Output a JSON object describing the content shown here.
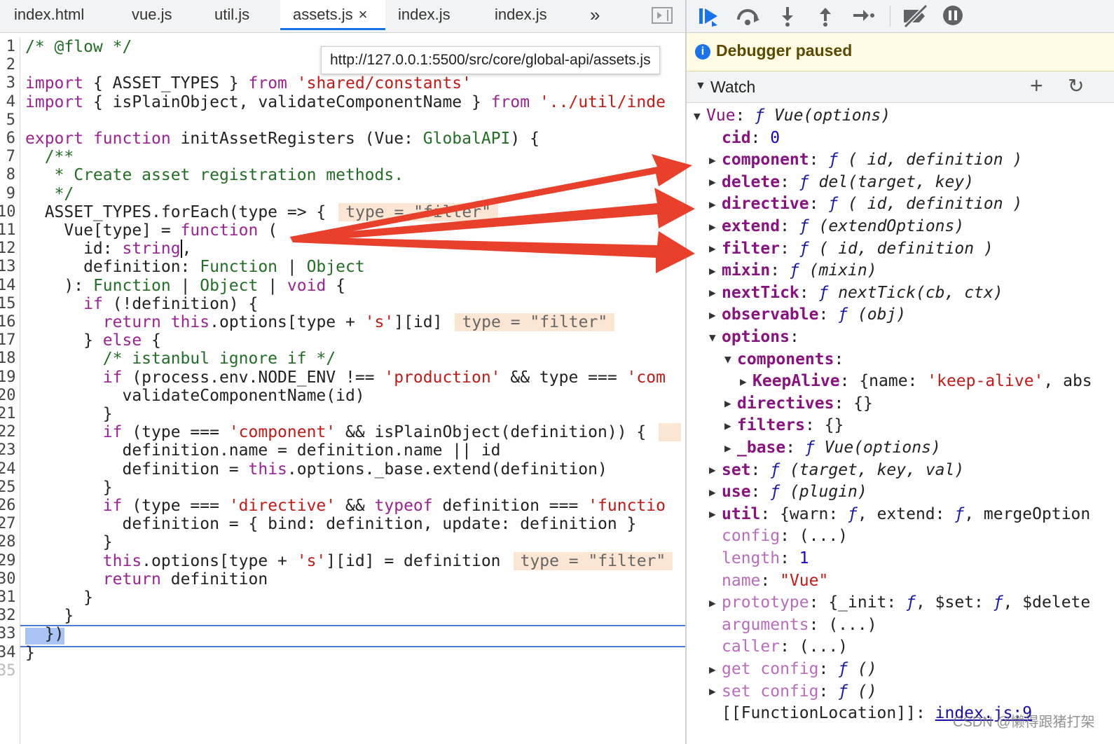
{
  "tabs": [
    {
      "label": "index.html",
      "active": false
    },
    {
      "label": "vue.js",
      "active": false
    },
    {
      "label": "util.js",
      "active": false
    },
    {
      "label": "assets.js",
      "active": true
    },
    {
      "label": "index.js",
      "active": false
    },
    {
      "label": "index.js",
      "active": false
    }
  ],
  "tab_close": "×",
  "tab_overflow": "»",
  "tooltip": "http://127.0.0.1:5500/src/core/global-api/assets.js",
  "line_numbers": [
    "1",
    "2",
    "3",
    "4",
    "5",
    "6",
    "7",
    "8",
    "9",
    "10",
    "11",
    "12",
    "13",
    "14",
    "15",
    "16",
    "17",
    "18",
    "19",
    "20",
    "21",
    "22",
    "23",
    "24",
    "25",
    "26",
    "27",
    "28",
    "29",
    "30",
    "31",
    "32",
    "33",
    "34",
    "35"
  ],
  "code": [
    [
      {
        "c": "cm",
        "t": "/* @flow */"
      }
    ],
    [],
    [
      {
        "c": "kw",
        "t": "import"
      },
      {
        "c": "",
        "t": " { ASSET_TYPES } "
      },
      {
        "c": "kw",
        "t": "from"
      },
      {
        "c": "",
        "t": " "
      },
      {
        "c": "str",
        "t": "'shared/constants'"
      }
    ],
    [
      {
        "c": "kw",
        "t": "import"
      },
      {
        "c": "",
        "t": " { isPlainObject, validateComponentName } "
      },
      {
        "c": "kw",
        "t": "from"
      },
      {
        "c": "",
        "t": " "
      },
      {
        "c": "str",
        "t": "'../util/inde"
      }
    ],
    [],
    [
      {
        "c": "kw",
        "t": "export"
      },
      {
        "c": "",
        "t": " "
      },
      {
        "c": "kw",
        "t": "function"
      },
      {
        "c": "",
        "t": " initAssetRegisters (Vue: "
      },
      {
        "c": "ty",
        "t": "GlobalAPI"
      },
      {
        "c": "",
        "t": ") {"
      }
    ],
    [
      {
        "c": "cm",
        "t": "  /**"
      }
    ],
    [
      {
        "c": "cm",
        "t": "   * Create asset registration methods."
      }
    ],
    [
      {
        "c": "cm",
        "t": "   */"
      }
    ],
    [
      {
        "c": "",
        "t": "  ASSET_TYPES.forEach(type => {"
      },
      {
        "c": "inl",
        "t": "type = \"filter\""
      }
    ],
    [
      {
        "c": "",
        "t": "    Vue[type] = "
      },
      {
        "c": "kw",
        "t": "function"
      },
      {
        "c": "",
        "t": " ("
      }
    ],
    [
      {
        "c": "",
        "t": "      id: "
      },
      {
        "c": "kw",
        "t": "string"
      },
      {
        "c": "cur",
        "t": ","
      }
    ],
    [
      {
        "c": "",
        "t": "      definition: "
      },
      {
        "c": "ty",
        "t": "Function"
      },
      {
        "c": "",
        "t": " | "
      },
      {
        "c": "ty",
        "t": "Object"
      }
    ],
    [
      {
        "c": "",
        "t": "    ): "
      },
      {
        "c": "ty",
        "t": "Function"
      },
      {
        "c": "",
        "t": " | "
      },
      {
        "c": "ty",
        "t": "Object"
      },
      {
        "c": "",
        "t": " | "
      },
      {
        "c": "kw",
        "t": "void"
      },
      {
        "c": "",
        "t": " {"
      }
    ],
    [
      {
        "c": "",
        "t": "      "
      },
      {
        "c": "kw",
        "t": "if"
      },
      {
        "c": "",
        "t": " (!definition) {"
      }
    ],
    [
      {
        "c": "",
        "t": "        "
      },
      {
        "c": "kw",
        "t": "return"
      },
      {
        "c": "",
        "t": " "
      },
      {
        "c": "kw",
        "t": "this"
      },
      {
        "c": "",
        "t": ".options[type + "
      },
      {
        "c": "str",
        "t": "'s'"
      },
      {
        "c": "",
        "t": "][id]"
      },
      {
        "c": "inl",
        "t": "type = \"filter\""
      }
    ],
    [
      {
        "c": "",
        "t": "      } "
      },
      {
        "c": "kw",
        "t": "else"
      },
      {
        "c": "",
        "t": " {"
      }
    ],
    [
      {
        "c": "cm",
        "t": "        /* istanbul ignore if */"
      }
    ],
    [
      {
        "c": "",
        "t": "        "
      },
      {
        "c": "kw",
        "t": "if"
      },
      {
        "c": "",
        "t": " (process.env.NODE_ENV !== "
      },
      {
        "c": "str",
        "t": "'production'"
      },
      {
        "c": "",
        "t": " && type === "
      },
      {
        "c": "str",
        "t": "'com"
      }
    ],
    [
      {
        "c": "",
        "t": "          validateComponentName(id)"
      }
    ],
    [
      {
        "c": "",
        "t": "        }"
      }
    ],
    [
      {
        "c": "",
        "t": "        "
      },
      {
        "c": "kw",
        "t": "if"
      },
      {
        "c": "",
        "t": " (type === "
      },
      {
        "c": "str",
        "t": "'component'"
      },
      {
        "c": "",
        "t": " && isPlainObject(definition)) {"
      },
      {
        "c": "inl",
        "t": ""
      }
    ],
    [
      {
        "c": "",
        "t": "          definition.name = definition.name || id"
      }
    ],
    [
      {
        "c": "",
        "t": "          definition = "
      },
      {
        "c": "kw",
        "t": "this"
      },
      {
        "c": "",
        "t": ".options._base.extend(definition)"
      }
    ],
    [
      {
        "c": "",
        "t": "        }"
      }
    ],
    [
      {
        "c": "",
        "t": "        "
      },
      {
        "c": "kw",
        "t": "if"
      },
      {
        "c": "",
        "t": " (type === "
      },
      {
        "c": "str",
        "t": "'directive'"
      },
      {
        "c": "",
        "t": " && "
      },
      {
        "c": "kw",
        "t": "typeof"
      },
      {
        "c": "",
        "t": " definition === "
      },
      {
        "c": "str",
        "t": "'functio"
      }
    ],
    [
      {
        "c": "",
        "t": "          definition = { bind: definition, update: definition }"
      }
    ],
    [
      {
        "c": "",
        "t": "        }"
      }
    ],
    [
      {
        "c": "",
        "t": "        "
      },
      {
        "c": "kw",
        "t": "this"
      },
      {
        "c": "",
        "t": ".options[type + "
      },
      {
        "c": "str",
        "t": "'s'"
      },
      {
        "c": "",
        "t": "][id] = definition"
      },
      {
        "c": "inl",
        "t": "type = \"filter\""
      }
    ],
    [
      {
        "c": "",
        "t": "        "
      },
      {
        "c": "kw",
        "t": "return"
      },
      {
        "c": "",
        "t": " definition"
      }
    ],
    [
      {
        "c": "",
        "t": "      }"
      }
    ],
    [
      {
        "c": "",
        "t": "    }"
      }
    ],
    [
      {
        "c": "",
        "t": "  })"
      }
    ],
    [
      {
        "c": "",
        "t": "}"
      }
    ],
    []
  ],
  "debugger": {
    "paused_text": "Debugger paused",
    "watch_label": "Watch",
    "add_label": "+",
    "refresh_label": "↻"
  },
  "tree": [
    {
      "ind": 0,
      "tw": "▼",
      "parts": [
        {
          "c": "kn",
          "t": "Vue"
        },
        {
          "c": "",
          "t": ": "
        },
        {
          "c": "f",
          "t": "ƒ"
        },
        {
          "c": "it",
          "t": " Vue(options)"
        }
      ]
    },
    {
      "ind": 1,
      "tw": "",
      "parts": [
        {
          "c": "k",
          "t": "cid"
        },
        {
          "c": "",
          "t": ": "
        },
        {
          "c": "n",
          "t": "0"
        }
      ]
    },
    {
      "ind": 1,
      "tw": "▶",
      "parts": [
        {
          "c": "k",
          "t": "component"
        },
        {
          "c": "",
          "t": ": "
        },
        {
          "c": "f",
          "t": "ƒ"
        },
        {
          "c": "it",
          "t": " ( id, definition )"
        }
      ]
    },
    {
      "ind": 1,
      "tw": "▶",
      "parts": [
        {
          "c": "k",
          "t": "delete"
        },
        {
          "c": "",
          "t": ": "
        },
        {
          "c": "f",
          "t": "ƒ"
        },
        {
          "c": "it",
          "t": " del(target, key)"
        }
      ]
    },
    {
      "ind": 1,
      "tw": "▶",
      "parts": [
        {
          "c": "k",
          "t": "directive"
        },
        {
          "c": "",
          "t": ": "
        },
        {
          "c": "f",
          "t": "ƒ"
        },
        {
          "c": "it",
          "t": " ( id, definition )"
        }
      ]
    },
    {
      "ind": 1,
      "tw": "▶",
      "parts": [
        {
          "c": "k",
          "t": "extend"
        },
        {
          "c": "",
          "t": ": "
        },
        {
          "c": "f",
          "t": "ƒ"
        },
        {
          "c": "it",
          "t": " (extendOptions)"
        }
      ]
    },
    {
      "ind": 1,
      "tw": "▶",
      "parts": [
        {
          "c": "k",
          "t": "filter"
        },
        {
          "c": "",
          "t": ": "
        },
        {
          "c": "f",
          "t": "ƒ"
        },
        {
          "c": "it",
          "t": " ( id, definition )"
        }
      ]
    },
    {
      "ind": 1,
      "tw": "▶",
      "parts": [
        {
          "c": "k",
          "t": "mixin"
        },
        {
          "c": "",
          "t": ": "
        },
        {
          "c": "f",
          "t": "ƒ"
        },
        {
          "c": "it",
          "t": " (mixin)"
        }
      ]
    },
    {
      "ind": 1,
      "tw": "▶",
      "parts": [
        {
          "c": "k",
          "t": "nextTick"
        },
        {
          "c": "",
          "t": ": "
        },
        {
          "c": "f",
          "t": "ƒ"
        },
        {
          "c": "it",
          "t": " nextTick(cb, ctx)"
        }
      ]
    },
    {
      "ind": 1,
      "tw": "▶",
      "parts": [
        {
          "c": "k",
          "t": "observable"
        },
        {
          "c": "",
          "t": ": "
        },
        {
          "c": "f",
          "t": "ƒ"
        },
        {
          "c": "it",
          "t": " (obj)"
        }
      ]
    },
    {
      "ind": 1,
      "tw": "▼",
      "parts": [
        {
          "c": "k",
          "t": "options"
        },
        {
          "c": "",
          "t": ":"
        }
      ]
    },
    {
      "ind": 2,
      "tw": "▼",
      "parts": [
        {
          "c": "k",
          "t": "components"
        },
        {
          "c": "",
          "t": ":"
        }
      ]
    },
    {
      "ind": 3,
      "tw": "▶",
      "parts": [
        {
          "c": "k",
          "t": "KeepAlive"
        },
        {
          "c": "",
          "t": ": {name: "
        },
        {
          "c": "s",
          "t": "'keep-alive'"
        },
        {
          "c": "",
          "t": ", abs"
        }
      ]
    },
    {
      "ind": 2,
      "tw": "▶",
      "parts": [
        {
          "c": "k",
          "t": "directives"
        },
        {
          "c": "",
          "t": ": {}"
        }
      ]
    },
    {
      "ind": 2,
      "tw": "▶",
      "parts": [
        {
          "c": "k",
          "t": "filters"
        },
        {
          "c": "",
          "t": ": {}"
        }
      ]
    },
    {
      "ind": 2,
      "tw": "▶",
      "parts": [
        {
          "c": "k",
          "t": "_base"
        },
        {
          "c": "",
          "t": ": "
        },
        {
          "c": "f",
          "t": "ƒ"
        },
        {
          "c": "it",
          "t": " Vue(options)"
        }
      ]
    },
    {
      "ind": 1,
      "tw": "▶",
      "parts": [
        {
          "c": "k",
          "t": "set"
        },
        {
          "c": "",
          "t": ": "
        },
        {
          "c": "f",
          "t": "ƒ"
        },
        {
          "c": "it",
          "t": " (target, key, val)"
        }
      ]
    },
    {
      "ind": 1,
      "tw": "▶",
      "parts": [
        {
          "c": "k",
          "t": "use"
        },
        {
          "c": "",
          "t": ": "
        },
        {
          "c": "f",
          "t": "ƒ"
        },
        {
          "c": "it",
          "t": " (plugin)"
        }
      ]
    },
    {
      "ind": 1,
      "tw": "▶",
      "parts": [
        {
          "c": "k",
          "t": "util"
        },
        {
          "c": "",
          "t": ": {warn: "
        },
        {
          "c": "f",
          "t": "ƒ"
        },
        {
          "c": "",
          "t": ", extend: "
        },
        {
          "c": "f",
          "t": "ƒ"
        },
        {
          "c": "",
          "t": ", mergeOption"
        }
      ]
    },
    {
      "ind": 1,
      "tw": "",
      "parts": [
        {
          "c": "kd",
          "t": "config"
        },
        {
          "c": "",
          "t": ": (...)"
        }
      ]
    },
    {
      "ind": 1,
      "tw": "",
      "parts": [
        {
          "c": "kd",
          "t": "length"
        },
        {
          "c": "",
          "t": ": "
        },
        {
          "c": "n",
          "t": "1"
        }
      ]
    },
    {
      "ind": 1,
      "tw": "",
      "parts": [
        {
          "c": "kd",
          "t": "name"
        },
        {
          "c": "",
          "t": ": "
        },
        {
          "c": "s",
          "t": "\"Vue\""
        }
      ]
    },
    {
      "ind": 1,
      "tw": "▶",
      "parts": [
        {
          "c": "kd",
          "t": "prototype"
        },
        {
          "c": "",
          "t": ": {_init: "
        },
        {
          "c": "f",
          "t": "ƒ"
        },
        {
          "c": "",
          "t": ", $set: "
        },
        {
          "c": "f",
          "t": "ƒ"
        },
        {
          "c": "",
          "t": ", $delete"
        }
      ]
    },
    {
      "ind": 1,
      "tw": "",
      "parts": [
        {
          "c": "kd",
          "t": "arguments"
        },
        {
          "c": "",
          "t": ": (...)"
        }
      ]
    },
    {
      "ind": 1,
      "tw": "",
      "parts": [
        {
          "c": "kd",
          "t": "caller"
        },
        {
          "c": "",
          "t": ": (...)"
        }
      ]
    },
    {
      "ind": 1,
      "tw": "▶",
      "parts": [
        {
          "c": "kd",
          "t": "get config"
        },
        {
          "c": "",
          "t": ": "
        },
        {
          "c": "f",
          "t": "ƒ"
        },
        {
          "c": "it",
          "t": " ()"
        }
      ]
    },
    {
      "ind": 1,
      "tw": "▶",
      "parts": [
        {
          "c": "kd",
          "t": "set config"
        },
        {
          "c": "",
          "t": ": "
        },
        {
          "c": "f",
          "t": "ƒ"
        },
        {
          "c": "it",
          "t": " ()"
        }
      ]
    },
    {
      "ind": 1,
      "tw": "",
      "parts": [
        {
          "c": "",
          "t": "[[FunctionLocation]]: "
        },
        {
          "c": "lnk",
          "t": "index.js:9"
        }
      ]
    }
  ],
  "watermark": "CSDN @懒得跟猪打架",
  "colors": {
    "accent": "#1a73e8",
    "arrow": "#e8402a",
    "paused_bg": "#fffbe5"
  }
}
